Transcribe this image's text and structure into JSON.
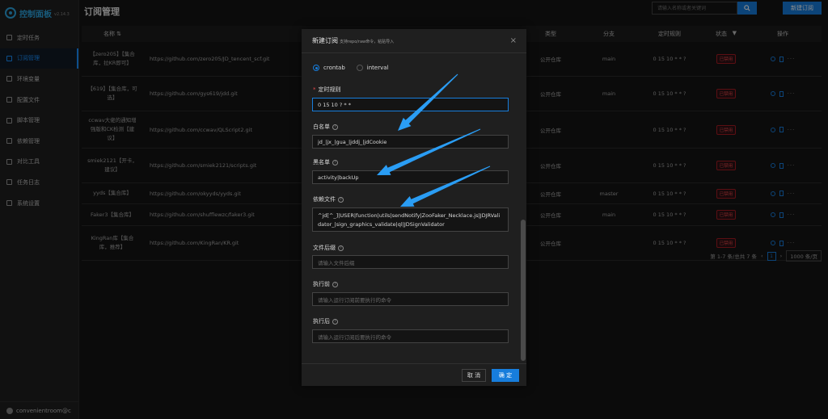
{
  "app": {
    "name": "控制面板",
    "version": "v2.14.3"
  },
  "sidebar": {
    "items": [
      {
        "label": "定时任务",
        "icon": "clock-icon"
      },
      {
        "label": "订阅管理",
        "icon": "subscribe-icon",
        "active": true
      },
      {
        "label": "环境变量",
        "icon": "variable-icon"
      },
      {
        "label": "配置文件",
        "icon": "config-icon"
      },
      {
        "label": "脚本管理",
        "icon": "script-icon"
      },
      {
        "label": "依赖管理",
        "icon": "dependency-icon"
      },
      {
        "label": "对比工具",
        "icon": "diff-icon"
      },
      {
        "label": "任务日志",
        "icon": "log-icon"
      },
      {
        "label": "系统设置",
        "icon": "settings-icon"
      }
    ],
    "user": "convenientroom@c"
  },
  "header": {
    "title": "订阅管理",
    "search_placeholder": "请输入名称或者关键词",
    "new_button": "新建订阅"
  },
  "table": {
    "columns": {
      "name": "名称",
      "type": "类型",
      "branch": "分支",
      "cron": "定时规则",
      "status": "状态",
      "ops": "操作"
    },
    "rows": [
      {
        "name": "【zero205】【集合库，拉KR即可】",
        "url": "https://github.com/zero205/JD_tencent_scf.git",
        "type": "公开仓库",
        "branch": "main",
        "cron": "0 15 10 * * ?",
        "status": "已禁用"
      },
      {
        "name": "【619】【集合库，可选】",
        "url": "https://github.com/gys619/jdd.git",
        "type": "公开仓库",
        "branch": "main",
        "cron": "0 15 10 * * ?",
        "status": "已禁用"
      },
      {
        "name": "ccwav大佬的通知增强版和CK检测【建议】",
        "url": "https://github.com/ccwav/QLScript2.git",
        "type": "公开仓库",
        "branch": "",
        "cron": "0 15 10 * * ?",
        "status": "已禁用"
      },
      {
        "name": "smiek2121【开卡，建议】",
        "url": "https://github.com/smiek2121/scripts.git",
        "type": "公开仓库",
        "branch": "",
        "cron": "0 15 10 * * ?",
        "status": "已禁用"
      },
      {
        "name": "yyds【集合库】",
        "url": "https://github.com/okyyds/yyds.git",
        "type": "公开仓库",
        "branch": "master",
        "cron": "0 15 10 * * ?",
        "status": "已禁用"
      },
      {
        "name": "Faker3【集合库】",
        "url": "https://github.com/shufflewzc/faker3.git",
        "type": "公开仓库",
        "branch": "main",
        "cron": "0 15 10 * * ?",
        "status": "已禁用"
      },
      {
        "name": "KingRan库【集合库，推荐】",
        "url": "https://github.com/KingRan/KR.git",
        "type": "公开仓库",
        "branch": "",
        "cron": "0 15 10 * * ?",
        "status": "已禁用"
      }
    ]
  },
  "pagination": {
    "summary": "第 1-7 条/总共 7 条",
    "page": "1",
    "page_size": "1000 条/页"
  },
  "modal": {
    "title": "新建订阅",
    "subtitle": "支持repo/raw命令，粘贴导入",
    "close": "×",
    "schedule_type_options": [
      "crontab",
      "interval"
    ],
    "schedule_type_value": "crontab",
    "cron_label": "定时规则",
    "cron_value": "0 15 10 ? * *",
    "whitelist_label": "白名单",
    "whitelist_value": "jd_|jx_|gua_|jddj_|jdCookie",
    "blacklist_label": "黑名单",
    "blacklist_value": "activity|backUp",
    "dependency_label": "依赖文件",
    "dependency_value": "^jd[^_]|USER|function|utils|sendNotify|ZooFaker_Necklace.js|JDJRValidator_|sign_graphics_validate|ql|JDSignValidator",
    "suffix_label": "文件后缀",
    "suffix_placeholder": "请输入文件后缀",
    "before_label": "执行前",
    "before_placeholder": "请输入运行订阅前要执行的命令",
    "after_label": "执行后",
    "after_placeholder": "请输入运行订阅后要执行的命令",
    "cancel": "取 消",
    "ok": "确 定"
  },
  "accent_color": "#177ddc",
  "arrow_color": "#2a9df4"
}
